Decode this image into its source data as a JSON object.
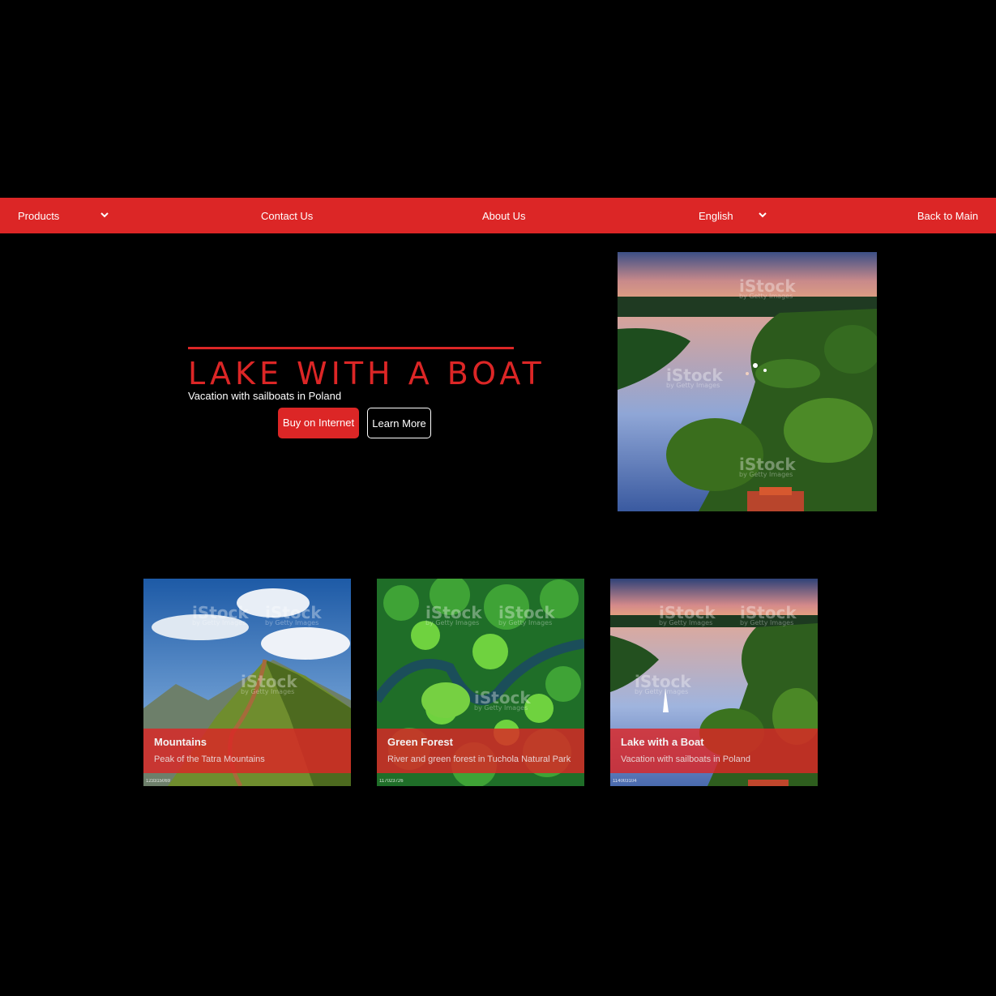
{
  "nav": {
    "products": "Products",
    "contact": "Contact Us",
    "about": "About Us",
    "language": "English",
    "back": "Back to Main"
  },
  "hero": {
    "title": "LAKE WITH A BOAT",
    "subtitle": "Vacation with sailboats in Poland",
    "buy_label": "Buy on Internet",
    "learn_label": "Learn More"
  },
  "watermark": {
    "brand": "iStock",
    "by": "by Getty Images"
  },
  "cards": [
    {
      "title": "Mountains",
      "desc": "Peak of the Tatra Mountains",
      "id": "123315069"
    },
    {
      "title": "Green Forest",
      "desc": "River and green forest in Tuchola Natural Park",
      "id": "117023726"
    },
    {
      "title": "Lake with a Boat",
      "desc": "Vacation with sailboats in Poland",
      "id": "114003104"
    }
  ],
  "colors": {
    "accent": "#dc2626",
    "background": "#000000"
  }
}
